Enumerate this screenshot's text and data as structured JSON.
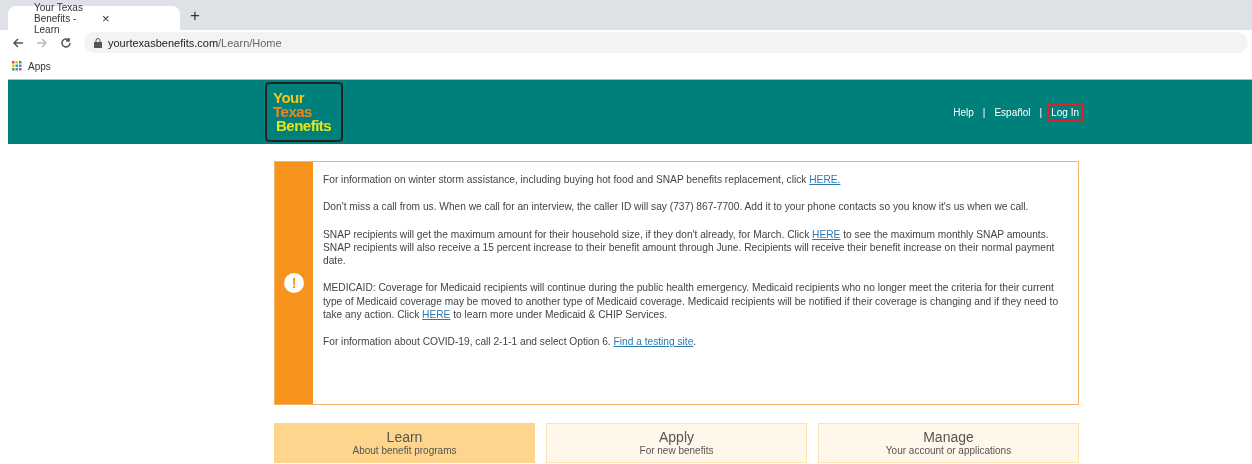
{
  "browser": {
    "tab_title": "Your Texas Benefits - Learn",
    "tab_close": "×",
    "new_tab": "+",
    "url_host": "yourtexasbenefits.com",
    "url_path": "/Learn/Home",
    "bookmarks": [
      "Apps"
    ]
  },
  "header": {
    "logo": [
      "Your",
      "Texas",
      "Benefits"
    ],
    "links": [
      {
        "label": "Help",
        "highlighted": false
      },
      {
        "label": "Español",
        "highlighted": false
      },
      {
        "label": "Log In",
        "highlighted": true
      }
    ],
    "separator": "|"
  },
  "alert": {
    "icon": "!",
    "paragraphs": [
      [
        {
          "kind": "text",
          "text": "For information on winter storm assistance, including buying hot food and SNAP benefits replacement, click "
        },
        {
          "kind": "link",
          "text": "HERE."
        }
      ],
      [
        {
          "kind": "text",
          "text": "Don't miss a call from us. When we call for an interview, the caller ID will say (737) 867-7700. Add it to your phone contacts so you know it's us when we call."
        }
      ],
      [
        {
          "kind": "text",
          "text": "SNAP recipients will get the maximum amount for their household size, if they don't already, for March. Click "
        },
        {
          "kind": "link",
          "text": "HERE"
        },
        {
          "kind": "text",
          "text": " to see the maximum monthly SNAP amounts. SNAP recipients will also receive a 15 percent increase to their benefit amount through June. Recipients will receive their benefit increase on their normal payment date."
        }
      ],
      [
        {
          "kind": "text",
          "text": "MEDICAID: Coverage for Medicaid recipients will continue during the public health emergency. Medicaid recipients who no longer meet the criteria for their current type of Medicaid coverage may be moved to another type of Medicaid coverage. Medicaid recipients will be notified if their coverage is changing and if they need to take any action. Click "
        },
        {
          "kind": "link",
          "text": "HERE"
        },
        {
          "kind": "text",
          "text": " to learn more under Medicaid & CHIP Services."
        }
      ],
      [
        {
          "kind": "text",
          "text": "For information about COVID-19, call 2-1-1 and select Option 6. "
        },
        {
          "kind": "link",
          "text": "Find a testing site"
        },
        {
          "kind": "text",
          "text": "."
        }
      ]
    ]
  },
  "tabs": [
    {
      "label": "Learn",
      "sublabel": "About benefit programs",
      "selected": true
    },
    {
      "label": "Apply",
      "sublabel": "For new benefits",
      "selected": false
    },
    {
      "label": "Manage",
      "sublabel": "Your account or applications",
      "selected": false
    }
  ]
}
